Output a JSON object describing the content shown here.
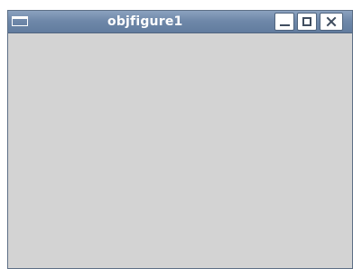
{
  "window": {
    "title": "objfigure1",
    "icons": {
      "menu": "window-menu-icon",
      "minimize": "minimize-icon",
      "maximize": "maximize-icon",
      "close": "close-icon"
    }
  },
  "colors": {
    "titlebar": "#6f88a9",
    "content_bg": "#d3d3d3",
    "border": "#5d6f86"
  }
}
